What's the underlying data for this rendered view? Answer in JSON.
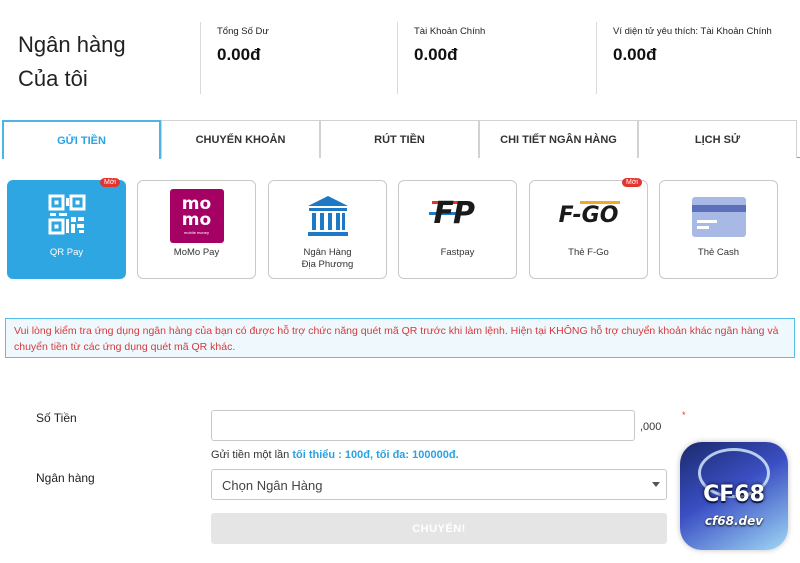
{
  "header": {
    "title_line1": "Ngân hàng",
    "title_line2": "Của tôi",
    "stats": [
      {
        "label": "Tổng Số Dư",
        "value": "0.00đ"
      },
      {
        "label": "Tài Khoản Chính",
        "value": "0.00đ"
      },
      {
        "label": "Ví diện tử yêu thích: Tài Khoản Chính",
        "value": "0.00đ"
      }
    ]
  },
  "tabs": [
    {
      "label": "GỬI TIỀN",
      "active": true
    },
    {
      "label": "CHUYỂN KHOẢN"
    },
    {
      "label": "RÚT TIỀN"
    },
    {
      "label": "CHI TIẾT NGÂN HÀNG"
    },
    {
      "label": "LỊCH SỬ"
    }
  ],
  "methods": [
    {
      "label": "QR Pay",
      "badge": "Mới",
      "active": true,
      "icon": "qr-code-icon"
    },
    {
      "label": "MoMo Pay",
      "icon": "momo-icon",
      "logo_text_top": "mo",
      "logo_text_bottom": "mo",
      "logo_sub": "mobile money"
    },
    {
      "label_line1": "Ngân Hàng",
      "label_line2": "Địa Phương",
      "icon": "bank-icon"
    },
    {
      "label": "Fastpay",
      "icon": "fastpay-icon",
      "logo_text": "FP"
    },
    {
      "label": "Thẻ F-Go",
      "badge": "Mới",
      "icon": "fgo-icon",
      "logo_text": "F-GO"
    },
    {
      "label": "Thẻ Cash",
      "icon": "card-icon"
    }
  ],
  "notice": "Vui lòng kiểm tra ứng dụng ngân hàng của bạn có được hỗ trợ chức năng quét mã QR trước khi làm lệnh. Hiện tại KHÔNG hỗ trợ chuyển khoản khác ngân hàng và chuyển tiền từ các ứng dụng quét mã QR khác.",
  "form": {
    "amount_label": "Số Tiền",
    "amount_value": "",
    "amount_suffix": ",000",
    "required_mark": "*",
    "hint_prefix": "Gửi tiền một lần",
    "hint_min": "tối thiểu : 100đ, tối đa: 100000đ.",
    "bank_label": "Ngân hàng",
    "bank_selected": "Chọn Ngân Hàng",
    "submit_label": "CHUYỂN!"
  },
  "watermark": {
    "brand": "CF68",
    "domain": "cf68.dev"
  },
  "colors": {
    "accent": "#2ea6e2",
    "notice_text": "#d83a3a",
    "badge": "#e3342f",
    "momo": "#a50064"
  }
}
